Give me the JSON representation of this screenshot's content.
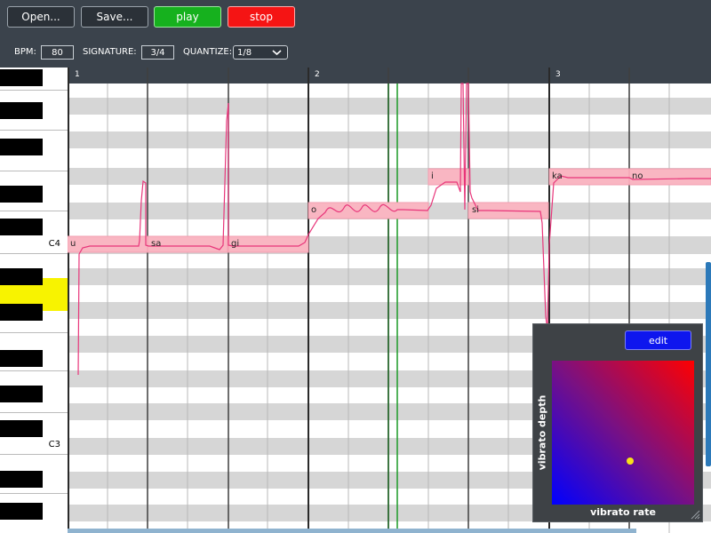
{
  "toolbar": {
    "open_label": "Open...",
    "save_label": "Save...",
    "play_label": "play",
    "stop_label": "stop"
  },
  "settings": {
    "bpm_label": "BPM:",
    "bpm_value": "80",
    "signature_label": "SIGNATURE:",
    "signature_value": "3/4",
    "quantize_label": "QUANTIZE:",
    "quantize_value": "1/8"
  },
  "keyboard": {
    "labels": [
      "C4",
      "C3"
    ],
    "highlighted_key": "yellow"
  },
  "timeline": {
    "measures": [
      "1",
      "2",
      "3"
    ]
  },
  "notes": [
    {
      "lyric": "u"
    },
    {
      "lyric": "sa"
    },
    {
      "lyric": "gi"
    },
    {
      "lyric": "o"
    },
    {
      "lyric": "i"
    },
    {
      "lyric": "si"
    },
    {
      "lyric": "ka"
    },
    {
      "lyric": "no"
    }
  ],
  "vibrato_panel": {
    "edit_label": "edit",
    "x_axis_label": "vibrato rate",
    "y_axis_label": "vibrato depth",
    "rate": 0.55,
    "depth": 0.3
  },
  "colors": {
    "note_fill": "#f9b6c2",
    "pitch_curve": "#e8357a",
    "playhead": "#1c9a26",
    "play_button": "#16b11e",
    "stop_button": "#f51414",
    "edit_button": "#0e16ee"
  }
}
